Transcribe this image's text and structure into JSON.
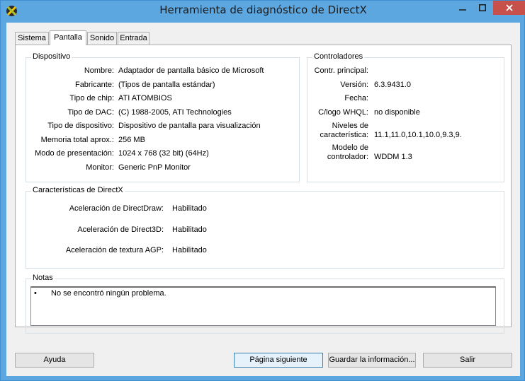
{
  "window": {
    "title": "Herramienta de diagnóstico de DirectX"
  },
  "tabs": [
    "Sistema",
    "Pantalla",
    "Sonido",
    "Entrada"
  ],
  "device": {
    "title": "Dispositivo",
    "rows": [
      {
        "label": "Nombre:",
        "value": "Adaptador de pantalla básico de Microsoft"
      },
      {
        "label": "Fabricante:",
        "value": "(Tipos de pantalla estándar)"
      },
      {
        "label": "Tipo de chip:",
        "value": "ATI ATOMBIOS"
      },
      {
        "label": "Tipo de DAC:",
        "value": "(C) 1988-2005, ATI Technologies"
      },
      {
        "label": "Tipo de dispositivo:",
        "value": "Dispositivo de pantalla para visualización"
      },
      {
        "label": "Memoria total aprox.:",
        "value": "256 MB"
      },
      {
        "label": "Modo de presentación:",
        "value": "1024 x 768 (32 bit) (64Hz)"
      },
      {
        "label": "Monitor:",
        "value": "Generic PnP Monitor"
      }
    ]
  },
  "drivers": {
    "title": "Controladores",
    "main_label": "Contr. principal:",
    "main_value": "",
    "version_label": "Versión:",
    "version_value": "6.3.9431.0",
    "date_label": "Fecha:",
    "date_value": "",
    "whql_label": "C/logo WHQL:",
    "whql_value": "no disponible",
    "levels_label_1": "Niveles de",
    "levels_label_2": "característica:",
    "levels_value": "11.1,11.0,10.1,10.0,9.3,9.",
    "model_label_1": "Modelo de",
    "model_label_2": "controlador:",
    "model_value": "WDDM 1.3"
  },
  "directx": {
    "title": "Características de DirectX",
    "rows": [
      {
        "label": "Aceleración de DirectDraw:",
        "value": "Habilitado"
      },
      {
        "label": "Aceleración de Direct3D:",
        "value": "Habilitado"
      },
      {
        "label": "Aceleración de textura AGP:",
        "value": "Habilitado"
      }
    ]
  },
  "notes": {
    "title": "Notas",
    "bullet": "•",
    "items": [
      "No se encontró ningún problema."
    ]
  },
  "buttons": {
    "help": "Ayuda",
    "next": "Página siguiente",
    "save": "Guardar la información...",
    "exit": "Salir"
  }
}
